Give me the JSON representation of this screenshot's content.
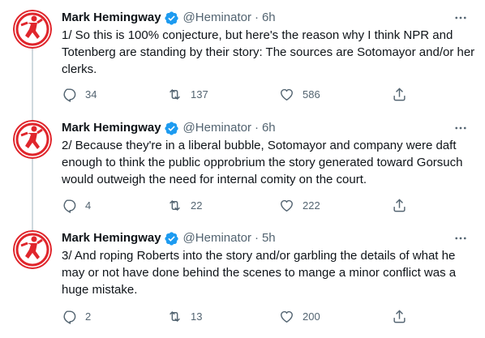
{
  "tweets": [
    {
      "name": "Mark Hemingway",
      "handle": "@Heminator",
      "separator": "·",
      "time": "6h",
      "text": "1/ So this is 100% conjecture, but here's the reason why I think NPR and Totenberg are standing by their story: The sources are Sotomayor and/or her clerks.",
      "replies": "34",
      "retweets": "137",
      "likes": "586"
    },
    {
      "name": "Mark Hemingway",
      "handle": "@Heminator",
      "separator": "·",
      "time": "6h",
      "text": "2/ Because they're in a liberal bubble, Sotomayor and company were daft enough to think the public opprobrium the story generated toward Gorsuch would outweigh the need for internal comity on the court.",
      "replies": "4",
      "retweets": "22",
      "likes": "222"
    },
    {
      "name": "Mark Hemingway",
      "handle": "@Heminator",
      "separator": "·",
      "time": "5h",
      "text": "3/ And roping Roberts into the story and/or garbling the details of what he may or not have done behind the scenes to mange a minor conflict was a huge mistake.",
      "replies": "2",
      "retweets": "13",
      "likes": "200"
    }
  ],
  "icons": {
    "avatar": "running-man-avatar-icon",
    "verified": "verified-badge-icon",
    "more": "more-options-icon",
    "reply": "reply-icon",
    "retweet": "retweet-icon",
    "like": "heart-icon",
    "share": "share-icon"
  },
  "colors": {
    "verified": "#1d9bf0",
    "secondary_text": "#536471",
    "thread_line": "#cfd9de",
    "avatar_accent": "#e0262c"
  }
}
